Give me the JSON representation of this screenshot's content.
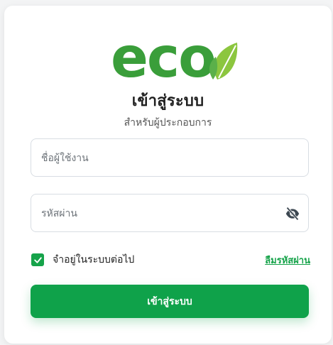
{
  "brand": {
    "logo_text": "eco",
    "primary_color": "#3a9e3a"
  },
  "header": {
    "title": "เข้าสู่ระบบ",
    "subtitle": "สำหรับผู้ประกอบการ"
  },
  "form": {
    "username_placeholder": "ชื่อผู้ใช้งาน",
    "password_placeholder": "รหัสผ่าน",
    "password_toggle_icon": "eye-slash-icon",
    "remember_label": "จำอยู่ในระบบต่อไป",
    "remember_checked": true,
    "forgot_label": "ลืมรหัสผ่าน",
    "submit_label": "เข้าสู่ระบบ"
  },
  "colors": {
    "accent": "#16a34a",
    "button": "#0fa24a"
  }
}
